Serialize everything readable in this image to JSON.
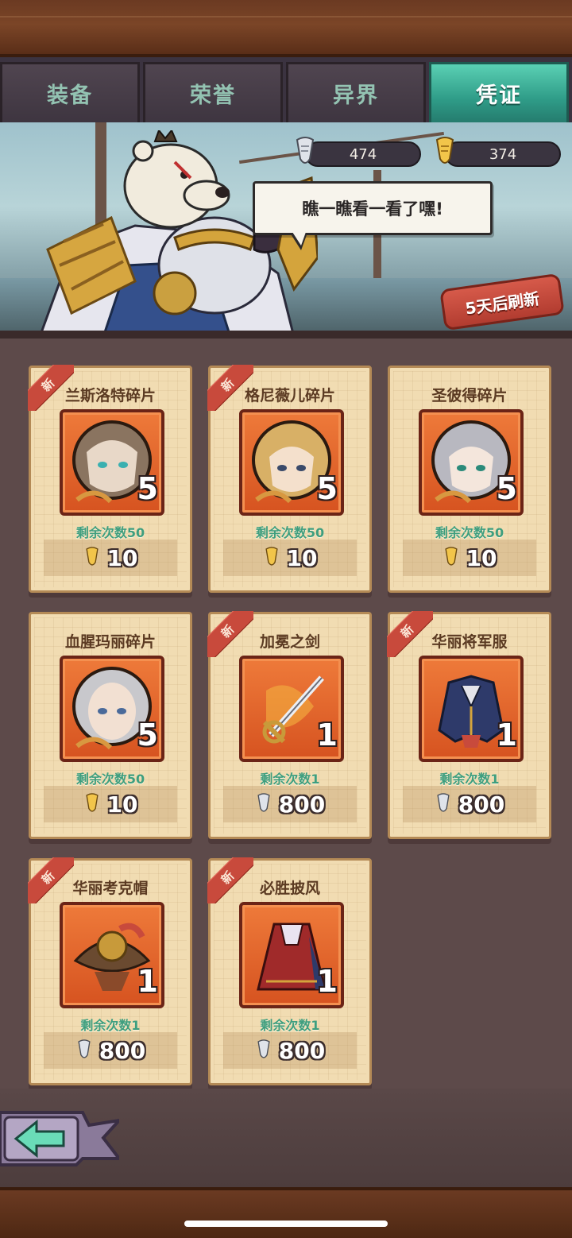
{
  "tabs": [
    {
      "label": "装备",
      "active": false
    },
    {
      "label": "荣誉",
      "active": false
    },
    {
      "label": "异界",
      "active": false
    },
    {
      "label": "凭证",
      "active": true
    }
  ],
  "currencies": [
    {
      "icon": "silver-scroll-icon",
      "value": "474"
    },
    {
      "icon": "gold-scroll-icon",
      "value": "374"
    }
  ],
  "speech": "瞧一瞧看一看了嘿!",
  "refresh_label": "5天后刷新",
  "shop_items": [
    {
      "name": "兰斯洛特碎片",
      "new": true,
      "new_label": "新",
      "qty": "5",
      "remaining": "剩余次数50",
      "price": "10",
      "currency": "gold-scroll-icon",
      "art": "portrait-cat"
    },
    {
      "name": "格尼薇儿碎片",
      "new": true,
      "new_label": "新",
      "qty": "5",
      "remaining": "剩余次数50",
      "price": "10",
      "currency": "gold-scroll-icon",
      "art": "portrait-blonde"
    },
    {
      "name": "圣彼得碎片",
      "new": false,
      "new_label": "",
      "qty": "5",
      "remaining": "剩余次数50",
      "price": "10",
      "currency": "gold-scroll-icon",
      "art": "portrait-silver"
    },
    {
      "name": "血腥玛丽碎片",
      "new": false,
      "new_label": "",
      "qty": "5",
      "remaining": "剩余次数50",
      "price": "10",
      "currency": "gold-scroll-icon",
      "art": "portrait-nun"
    },
    {
      "name": "加冕之剑",
      "new": true,
      "new_label": "新",
      "qty": "1",
      "remaining": "剩余次数1",
      "price": "800",
      "currency": "silver-scroll-icon",
      "art": "sword"
    },
    {
      "name": "华丽将军服",
      "new": true,
      "new_label": "新",
      "qty": "1",
      "remaining": "剩余次数1",
      "price": "800",
      "currency": "silver-scroll-icon",
      "art": "uniform"
    },
    {
      "name": "华丽考克帽",
      "new": true,
      "new_label": "新",
      "qty": "1",
      "remaining": "剩余次数1",
      "price": "800",
      "currency": "silver-scroll-icon",
      "art": "hat"
    },
    {
      "name": "必胜披风",
      "new": true,
      "new_label": "新",
      "qty": "1",
      "remaining": "剩余次数1",
      "price": "800",
      "currency": "silver-scroll-icon",
      "art": "cape"
    }
  ],
  "colors": {
    "accent": "#2f9c88",
    "badge": "#c84a3c",
    "remaining_text": "#3e9e7e"
  }
}
